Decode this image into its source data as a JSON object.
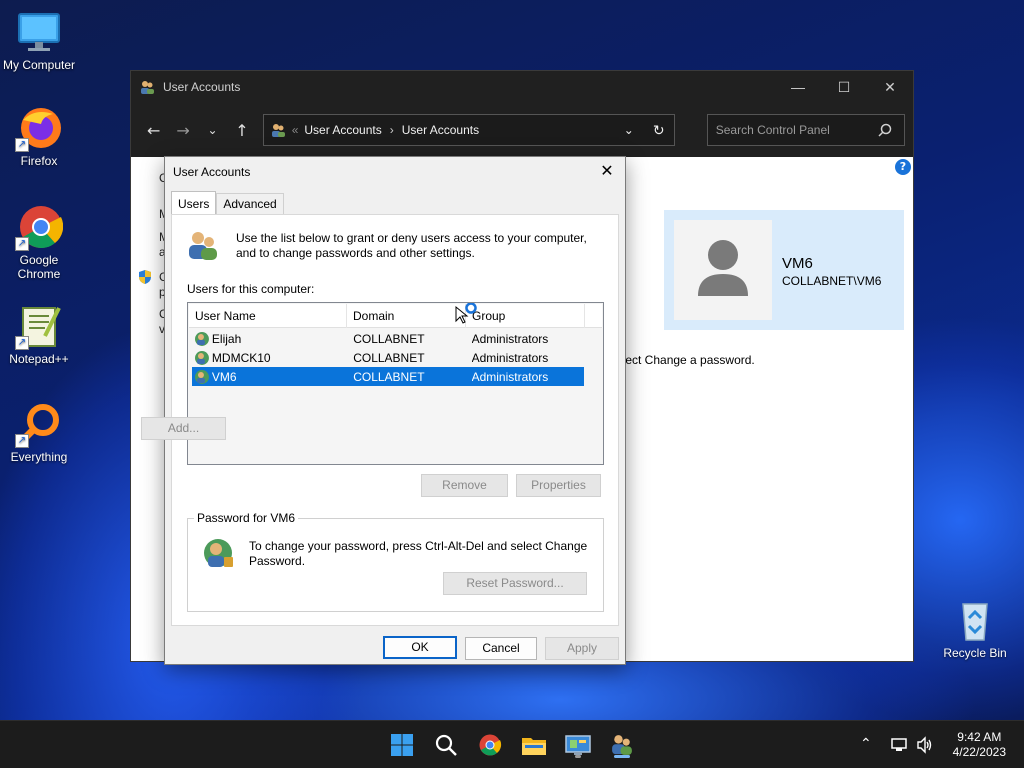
{
  "desktop": {
    "icons": [
      {
        "label": "My Computer"
      },
      {
        "label": "Firefox"
      },
      {
        "label": "Google Chrome"
      },
      {
        "label": "Notepad++"
      },
      {
        "label": "Everything"
      },
      {
        "label": "Recycle Bin"
      }
    ]
  },
  "control_panel": {
    "title": "User Accounts",
    "breadcrumb": [
      "User Accounts",
      "User Accounts"
    ],
    "search_placeholder": "Search Control Panel",
    "user_card": {
      "name": "VM6",
      "domain": "COLLABNET\\VM6"
    },
    "behind_text": "elect Change a password.",
    "help_label": "?"
  },
  "dialog": {
    "title": "User Accounts",
    "tabs": [
      "Users",
      "Advanced"
    ],
    "active_tab": "Users",
    "intro_text": "Use the list below to grant or deny users access to your computer, and to change passwords and other settings.",
    "users_label": "Users for this computer:",
    "columns": [
      "User Name",
      "Domain",
      "Group"
    ],
    "rows": [
      {
        "user": "Elijah",
        "domain": "COLLABNET",
        "group": "Administrators"
      },
      {
        "user": "MDMCK10",
        "domain": "COLLABNET",
        "group": "Administrators"
      },
      {
        "user": "VM6",
        "domain": "COLLABNET",
        "group": "Administrators"
      }
    ],
    "selected_row": 2,
    "buttons": {
      "add": "Add...",
      "remove": "Remove",
      "properties": "Properties"
    },
    "password_group": {
      "legend": "Password for VM6",
      "text": "To change your password, press Ctrl-Alt-Del and select Change Password.",
      "reset_button": "Reset Password..."
    },
    "footer": {
      "ok": "OK",
      "cancel": "Cancel",
      "apply": "Apply"
    }
  },
  "taskbar": {
    "time": "9:42 AM",
    "date": "4/22/2023"
  },
  "colors": {
    "selection": "#0a74da",
    "taskbar": "#1c1c1c",
    "user_card": "#d9ebfb"
  }
}
